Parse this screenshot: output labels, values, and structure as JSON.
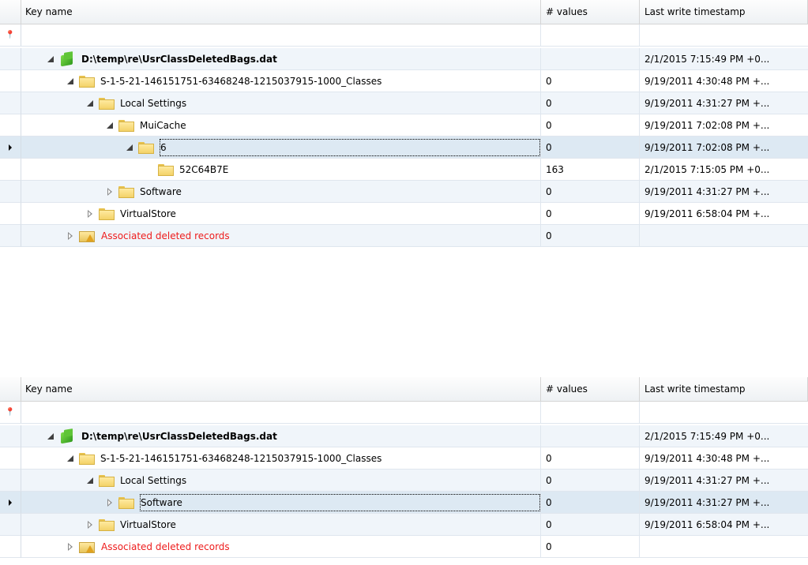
{
  "headers": {
    "key_name": "Key name",
    "num_values": "# values",
    "last_write": "Last write timestamp"
  },
  "icons": {
    "filter": "pin-icon",
    "hive": "registry-hive-icon",
    "folder": "folder-icon",
    "deleted": "folder-warning-icon",
    "row_indicator": "current-row-arrow-icon"
  },
  "colors": {
    "deleted_text": "#ee1c1c",
    "selected_row": "#dde9f3",
    "alt_row": "#f0f5fa"
  },
  "panels": [
    {
      "rows": [
        {
          "name": "D:\\temp\\re\\UsrClassDeletedBags.dat",
          "values": "",
          "timestamp": "2/1/2015 7:15:49 PM +0...",
          "level": 0,
          "expander": "expanded",
          "icon": "hive",
          "bold": true
        },
        {
          "name": "S-1-5-21-146151751-63468248-1215037915-1000_Classes",
          "values": "0",
          "timestamp": "9/19/2011 4:30:48 PM +...",
          "level": 1,
          "expander": "expanded",
          "icon": "folder"
        },
        {
          "name": "Local Settings",
          "values": "0",
          "timestamp": "9/19/2011 4:31:27 PM +...",
          "level": 2,
          "expander": "expanded",
          "icon": "folder"
        },
        {
          "name": "MuiCache",
          "values": "0",
          "timestamp": "9/19/2011 7:02:08 PM +...",
          "level": 3,
          "expander": "expanded",
          "icon": "folder"
        },
        {
          "name": "6",
          "values": "0",
          "timestamp": "9/19/2011 7:02:08 PM +...",
          "level": 4,
          "expander": "expanded",
          "icon": "folder",
          "selected": true
        },
        {
          "name": "52C64B7E",
          "values": "163",
          "timestamp": "2/1/2015 7:15:05 PM +0...",
          "level": 5,
          "expander": "none",
          "icon": "folder"
        },
        {
          "name": "Software",
          "values": "0",
          "timestamp": "9/19/2011 4:31:27 PM +...",
          "level": 3,
          "expander": "collapsed",
          "icon": "folder"
        },
        {
          "name": "VirtualStore",
          "values": "0",
          "timestamp": "9/19/2011 6:58:04 PM +...",
          "level": 2,
          "expander": "collapsed",
          "icon": "folder"
        },
        {
          "name": "Associated deleted records",
          "values": "0",
          "timestamp": "",
          "level": 1,
          "expander": "collapsed",
          "icon": "deleted",
          "red": true
        }
      ]
    },
    {
      "rows": [
        {
          "name": "D:\\temp\\re\\UsrClassDeletedBags.dat",
          "values": "",
          "timestamp": "2/1/2015 7:15:49 PM +0...",
          "level": 0,
          "expander": "expanded",
          "icon": "hive",
          "bold": true
        },
        {
          "name": "S-1-5-21-146151751-63468248-1215037915-1000_Classes",
          "values": "0",
          "timestamp": "9/19/2011 4:30:48 PM +...",
          "level": 1,
          "expander": "expanded",
          "icon": "folder"
        },
        {
          "name": "Local Settings",
          "values": "0",
          "timestamp": "9/19/2011 4:31:27 PM +...",
          "level": 2,
          "expander": "expanded",
          "icon": "folder"
        },
        {
          "name": "Software",
          "values": "0",
          "timestamp": "9/19/2011 4:31:27 PM +...",
          "level": 3,
          "expander": "collapsed",
          "icon": "folder",
          "selected": true
        },
        {
          "name": "VirtualStore",
          "values": "0",
          "timestamp": "9/19/2011 6:58:04 PM +...",
          "level": 2,
          "expander": "collapsed",
          "icon": "folder"
        },
        {
          "name": "Associated deleted records",
          "values": "0",
          "timestamp": "",
          "level": 1,
          "expander": "collapsed",
          "icon": "deleted",
          "red": true
        }
      ]
    }
  ]
}
